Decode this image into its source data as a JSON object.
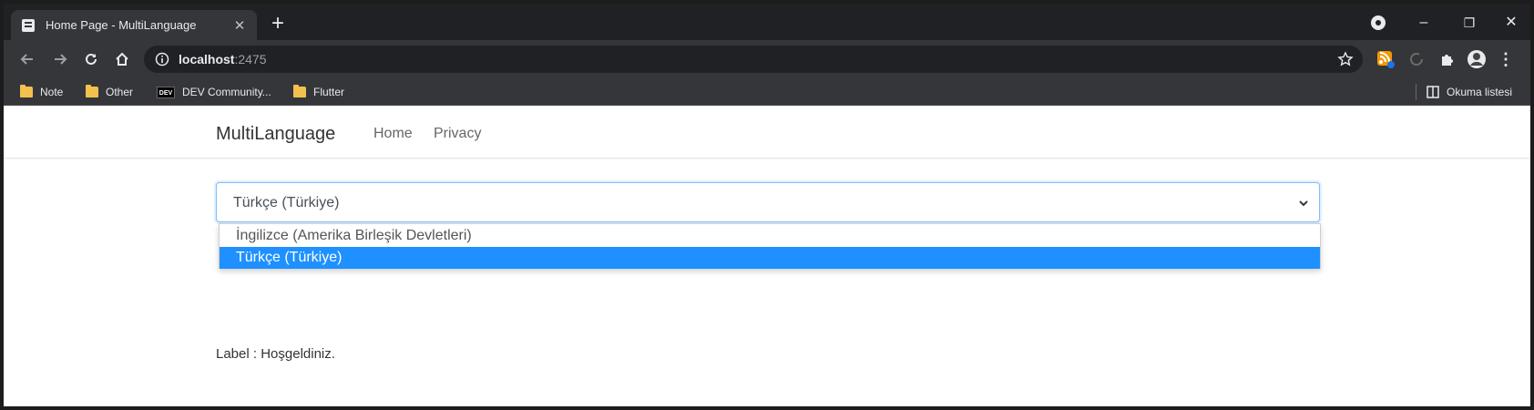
{
  "browser": {
    "tab_title": "Home Page - MultiLanguage",
    "tab_close": "✕",
    "new_tab": "+",
    "url_host": "localhost",
    "url_port": ":2475",
    "window_controls": {
      "minimize": "–",
      "restore": "❐",
      "close": "✕"
    },
    "bookmarks": [
      {
        "label": "Note",
        "icon": "folder-icon"
      },
      {
        "label": "Other",
        "icon": "folder-icon"
      },
      {
        "label": "DEV Community...",
        "icon": "dev-logo-icon",
        "logo_text": "DEV"
      },
      {
        "label": "Flutter",
        "icon": "folder-icon"
      }
    ],
    "reading_list": "Okuma listesi"
  },
  "app": {
    "brand": "MultiLanguage",
    "nav": [
      {
        "label": "Home"
      },
      {
        "label": "Privacy"
      }
    ],
    "culture_select": {
      "value": "Türkçe (Türkiye)",
      "options": [
        {
          "label": "İngilizce (Amerika Birleşik Devletleri)",
          "selected": false
        },
        {
          "label": "Türkçe (Türkiye)",
          "selected": true
        }
      ]
    },
    "label_text": "Label : Hoşgeldiniz."
  },
  "colors": {
    "tab_bar": "#202124",
    "toolbar": "#35363a",
    "selected_option": "#1e90ff",
    "select_focus_border": "#80bdff"
  }
}
